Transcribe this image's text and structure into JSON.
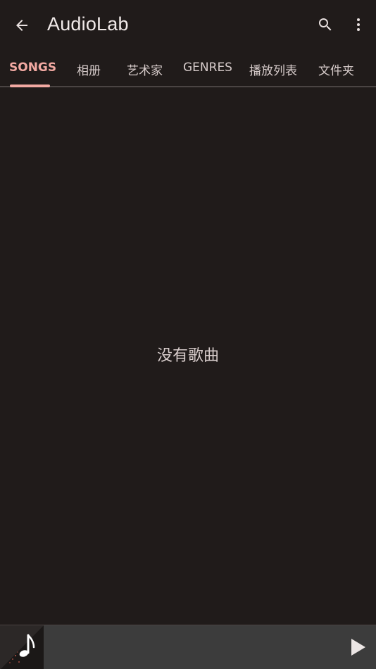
{
  "app": {
    "title": "AudioLab"
  },
  "tabs": [
    {
      "label": "SONGS",
      "active": true
    },
    {
      "label": "相册",
      "active": false
    },
    {
      "label": "艺术家",
      "active": false
    },
    {
      "label": "GENRES",
      "active": false
    },
    {
      "label": "播放列表",
      "active": false
    },
    {
      "label": "文件夹",
      "active": false
    }
  ],
  "empty_state": {
    "message": "没有歌曲"
  },
  "icons": {
    "back": "arrow-left-icon",
    "search": "search-icon",
    "more": "more-vertical-icon",
    "album_art": "music-note-icon",
    "play": "play-icon"
  },
  "colors": {
    "background": "#201b1a",
    "accent": "#f2a9a2",
    "player_bar": "#3c3c3c"
  }
}
